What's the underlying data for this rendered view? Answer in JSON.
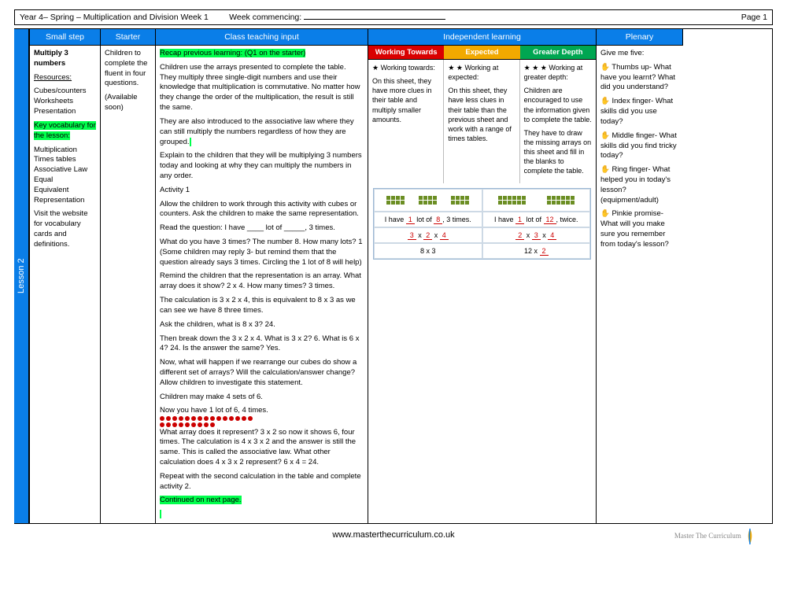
{
  "header": {
    "title": "Year 4– Spring – Multiplication and Division Week 1",
    "week_commencing_label": "Week commencing:",
    "page_label": "Page 1"
  },
  "lesson_tab": "Lesson 2",
  "columns": {
    "small_step": "Small step",
    "starter": "Starter",
    "class_input": "Class teaching input",
    "independent": "Independent learning",
    "plenary": "Plenary"
  },
  "small_step": {
    "title": "Multiply 3 numbers",
    "resources_label": "Resources:",
    "resources": "Cubes/counters\nWorksheets\nPresentation",
    "vocab_label": "Key vocabulary for the lesson:",
    "vocab": "Multiplication\nTimes tables\nAssociative Law\nEqual\nEquivalent\nRepresentation",
    "note": "Visit the website for vocabulary cards and definitions."
  },
  "starter": {
    "text": "Children to complete the fluent in four questions.",
    "avail": "(Available soon)"
  },
  "class_input": {
    "recap": "Recap previous learning: (Q1 on the starter)",
    "p1": "Children use the arrays presented to complete the table. They multiply three single-digit numbers and use their knowledge that multiplication is commutative. No matter how they change the order of the multiplication, the result is still the same.",
    "p2": "They are also introduced to the associative law where they can still multiply the numbers regardless of how they are grouped.",
    "p3": "Explain to the children that they will be multiplying 3 numbers today and looking  at why they can multiply the numbers in any order.",
    "act1": "Activity 1",
    "p4": "Allow the children to work through this activity with cubes or counters. Ask the children to make the same representation.",
    "p5": "Read the question: I have ____ lot of _____, 3 times.",
    "p6": "What do you have 3 times? The number 8. How many lots? 1 (Some children may reply 3- but remind them that the question already says 3 times. Circling the 1 lot of 8 will help)",
    "p7": "Remind the children that the representation is an array. What array does it show? 2 x 4. How many times? 3 times.",
    "p8": "The calculation is 3 x 2 x 4,  this is equivalent to 8 x 3 as we can see we have 8 three times.",
    "p9": "Ask the children, what is 8 x 3? 24.",
    "p10": "Then break down the 3 x 2 x 4. What is 3 x 2? 6. What is 6 x 4? 24. Is the answer the same? Yes.",
    "p11": "Now, what will happen if we rearrange our cubes do show a different set of arrays? Will the calculation/answer change? Allow children to investigate this statement.",
    "p12": "Children may make 4 sets of 6.",
    "p13a": "Now you have 1 lot of 6, 4 times.",
    "p13b": "What array does it represent? 3 x 2 so now it shows 6, four times.  The calculation is 4 x 3 x 2 and the answer is still the same. This is called the associative law. What other calculation does 4 x 3 x 2 represent? 6 x 4 = 24.",
    "p14": "Repeat with the second calculation in the table and complete activity 2.",
    "cont": "Continued on next page."
  },
  "independent": {
    "wt_h": "Working Towards",
    "ex_h": "Expected",
    "gd_h": "Greater Depth",
    "wt_star": "★  Working towards:",
    "wt_body": "On this sheet, they have more clues in their table and multiply smaller amounts.",
    "ex_star": "★ ★ Working at expected:",
    "ex_body": "On this sheet, they have less clues in their table than the previous sheet and work with a range of times tables.",
    "gd_star": "★ ★ ★ Working at greater depth:",
    "gd_b1": "Children are encouraged to use the information given to complete the table.",
    "gd_b2": "They have to draw the missing arrays on this sheet and fill in the blanks to complete the table."
  },
  "diagram": {
    "l1": {
      "text_a": "I have ",
      "one": "1",
      "text_b": " lot of ",
      "eight": "8",
      "text_c": ", 3 times."
    },
    "r1": {
      "text_a": "I have ",
      "one": "1",
      "text_b": " lot of ",
      "twelve": "12",
      "text_c": ", twice."
    },
    "l2": {
      "a": "3",
      "b": "2",
      "c": "4"
    },
    "r2": {
      "a": "2",
      "b": "3",
      "c": "4"
    },
    "l3": "8 x 3",
    "r3a": "12 x ",
    "r3b": "2"
  },
  "plenary": {
    "title": "Give me five:",
    "thumb": "✋ Thumbs up- What have you learnt? What did you understand?",
    "index": "✋ Index finger- What skills did you use today?",
    "middle": "✋ Middle finger- What skills did you find tricky today?",
    "ring": "✋ Ring finger- What helped you in today's lesson? (equipment/adult)",
    "pinkie": "✋ Pinkie promise- What will you make sure you remember from today's lesson?"
  },
  "footer": {
    "url": "www.masterthecurriculum.co.uk",
    "brand": "Master The Curriculum"
  }
}
